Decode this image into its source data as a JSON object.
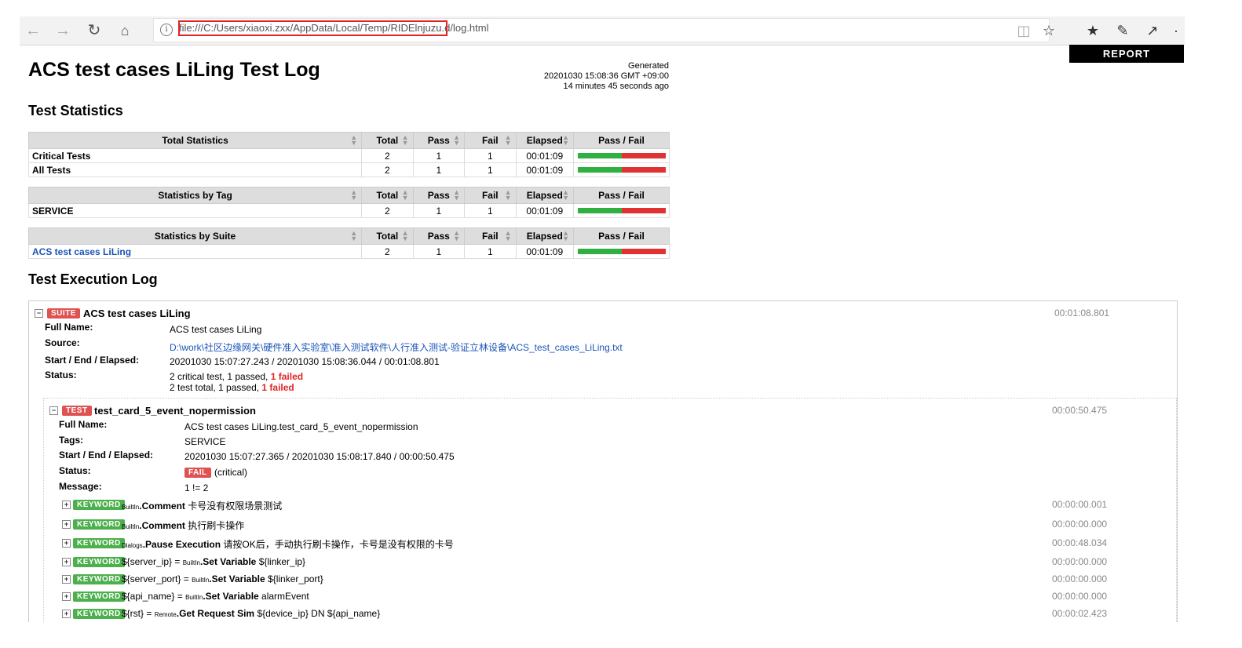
{
  "browser": {
    "url": "file:///C:/Users/xiaoxi.zxx/AppData/Local/Temp/RIDElnjuzu.d/log.html"
  },
  "report_button": "REPORT",
  "title": "ACS test cases LiLing Test Log",
  "generated": {
    "label": "Generated",
    "datetime": "20201030 15:08:36 GMT +09:00",
    "ago": "14 minutes 45 seconds ago"
  },
  "test_statistics": {
    "heading": "Test Statistics",
    "columns": [
      "Total",
      "Pass",
      "Fail",
      "Elapsed",
      "Pass / Fail"
    ],
    "total": {
      "header": "Total Statistics",
      "rows": [
        {
          "name": "Critical Tests",
          "total": "2",
          "pass": "1",
          "fail": "1",
          "elapsed": "00:01:09",
          "pass_ratio": 0.5
        },
        {
          "name": "All Tests",
          "total": "2",
          "pass": "1",
          "fail": "1",
          "elapsed": "00:01:09",
          "pass_ratio": 0.5
        }
      ]
    },
    "by_tag": {
      "header": "Statistics by Tag",
      "rows": [
        {
          "name": "SERVICE",
          "total": "2",
          "pass": "1",
          "fail": "1",
          "elapsed": "00:01:09",
          "pass_ratio": 0.5
        }
      ]
    },
    "by_suite": {
      "header": "Statistics by Suite",
      "rows": [
        {
          "name": "ACS test cases LiLing",
          "total": "2",
          "pass": "1",
          "fail": "1",
          "elapsed": "00:01:09",
          "pass_ratio": 0.5
        }
      ]
    }
  },
  "execution_log": {
    "heading": "Test Execution Log",
    "suite": {
      "label": "SUITE",
      "name": "ACS test cases LiLing",
      "elapsed": "00:01:08.801",
      "full_name_key": "Full Name:",
      "full_name": "ACS test cases LiLing",
      "source_key": "Source:",
      "source": "D:\\work\\社区边缘网关\\硬件准入实验室\\准入测试软件\\人行准入测试-验证立林设备\\ACS_test_cases_LiLing.txt",
      "start_key": "Start / End / Elapsed:",
      "start": "20201030 15:07:27.243 / 20201030 15:08:36.044 / 00:01:08.801",
      "status_key": "Status:",
      "status_line1": "2 critical test, 1 passed, ",
      "status_line1_fail": "1 failed",
      "status_line2": "2 test total, 1 passed, ",
      "status_line2_fail": "1 failed"
    },
    "test": {
      "label": "TEST",
      "name": "test_card_5_event_nopermission",
      "elapsed": "00:00:50.475",
      "full_name_key": "Full Name:",
      "full_name": "ACS test cases LiLing.test_card_5_event_nopermission",
      "tags_key": "Tags:",
      "tags": "SERVICE",
      "start_key": "Start / End / Elapsed:",
      "start": "20201030 15:07:27.365 / 20201030 15:08:17.840 / 00:00:50.475",
      "status_key": "Status:",
      "status_label": "FAIL",
      "status_extra": "(critical)",
      "message_key": "Message:",
      "message": "1 != 2"
    },
    "keywords": [
      {
        "label": "KEYWORD",
        "assign": "",
        "lib": "BuiltIn",
        "name": "Comment",
        "args": "卡号没有权限场景测试",
        "elapsed": "00:00:00.001"
      },
      {
        "label": "KEYWORD",
        "assign": "",
        "lib": "BuiltIn",
        "name": "Comment",
        "args": "执行刷卡操作",
        "elapsed": "00:00:00.000"
      },
      {
        "label": "KEYWORD",
        "assign": "",
        "lib": "Dialogs",
        "name": "Pause Execution",
        "args": "请按OK后，手动执行刷卡操作，卡号是没有权限的卡号",
        "elapsed": "00:00:48.034"
      },
      {
        "label": "KEYWORD",
        "assign": "${server_ip} = ",
        "lib": "BuiltIn",
        "name": "Set Variable",
        "args": "${linker_ip}",
        "elapsed": "00:00:00.000"
      },
      {
        "label": "KEYWORD",
        "assign": "${server_port} = ",
        "lib": "BuiltIn",
        "name": "Set Variable",
        "args": "${linker_port}",
        "elapsed": "00:00:00.000"
      },
      {
        "label": "KEYWORD",
        "assign": "${api_name} = ",
        "lib": "BuiltIn",
        "name": "Set Variable",
        "args": "alarmEvent",
        "elapsed": "00:00:00.000"
      },
      {
        "label": "KEYWORD",
        "assign": "${rst} = ",
        "lib": "Remote",
        "name": "Get Request Sim",
        "args": "${device_ip}  DN  ${api_name}",
        "elapsed": "00:00:02.423"
      }
    ]
  }
}
